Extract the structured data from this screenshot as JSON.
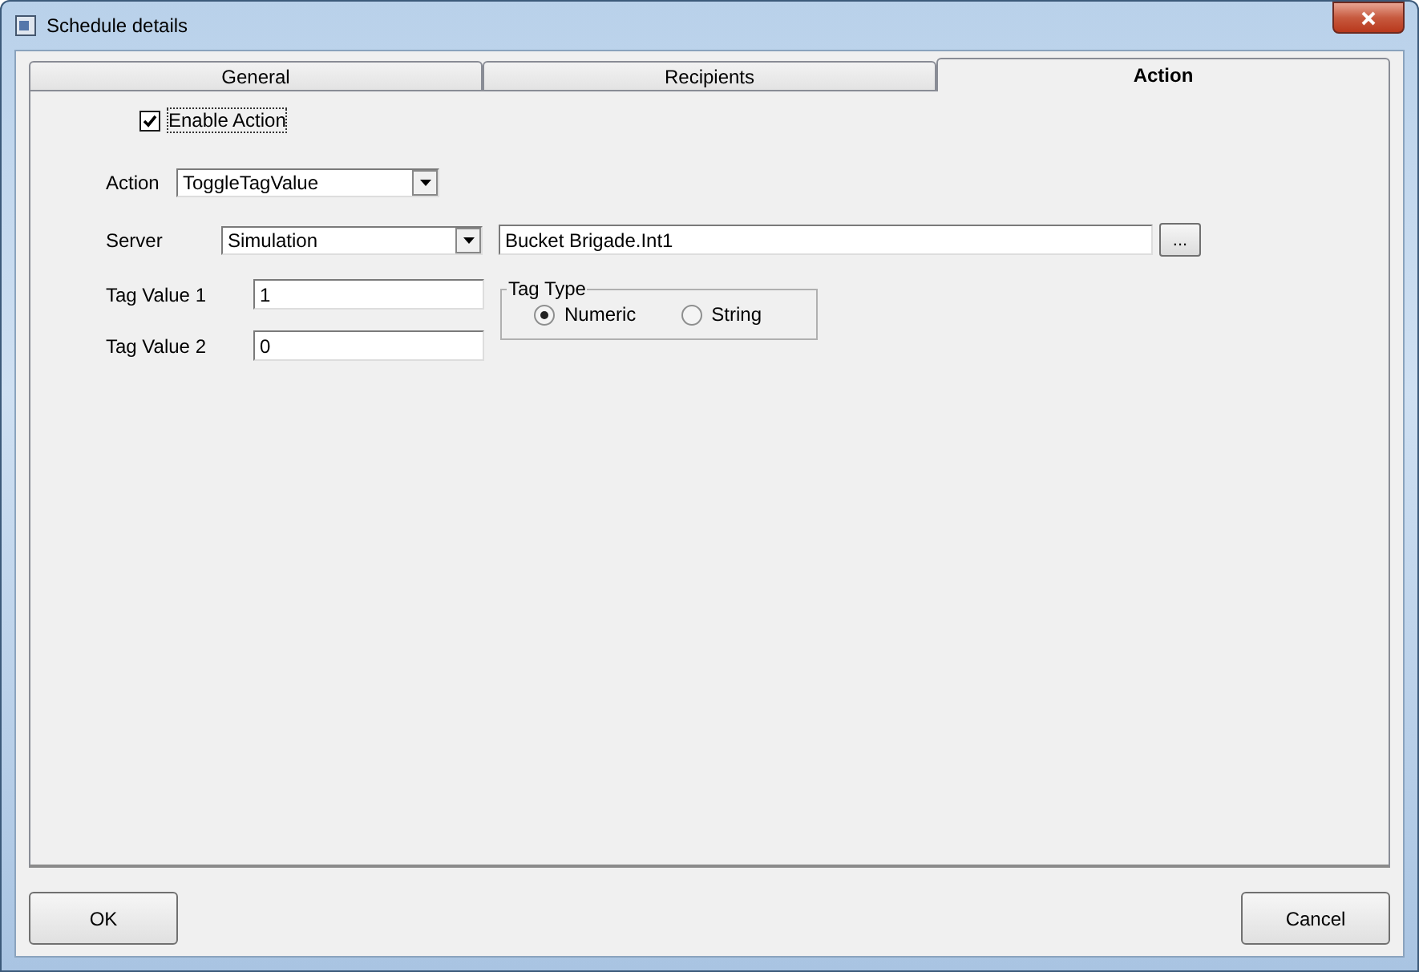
{
  "window": {
    "title": "Schedule details"
  },
  "tabs": [
    {
      "label": "General",
      "selected": false
    },
    {
      "label": "Recipients",
      "selected": false
    },
    {
      "label": "Action",
      "selected": true
    }
  ],
  "enable_action": {
    "label": "Enable Action",
    "checked": true
  },
  "action": {
    "label": "Action",
    "value": "ToggleTagValue"
  },
  "server": {
    "label": "Server",
    "value": "Simulation",
    "tag": "Bucket Brigade.Int1",
    "browse": "..."
  },
  "tag_value_1": {
    "label": "Tag Value 1",
    "value": "1"
  },
  "tag_value_2": {
    "label": "Tag Value 2",
    "value": "0"
  },
  "tag_type": {
    "title": "Tag Type",
    "options": [
      {
        "label": "Numeric",
        "selected": true
      },
      {
        "label": "String",
        "selected": false
      }
    ]
  },
  "buttons": [
    {
      "label": "OK"
    },
    {
      "label": "Cancel"
    }
  ]
}
